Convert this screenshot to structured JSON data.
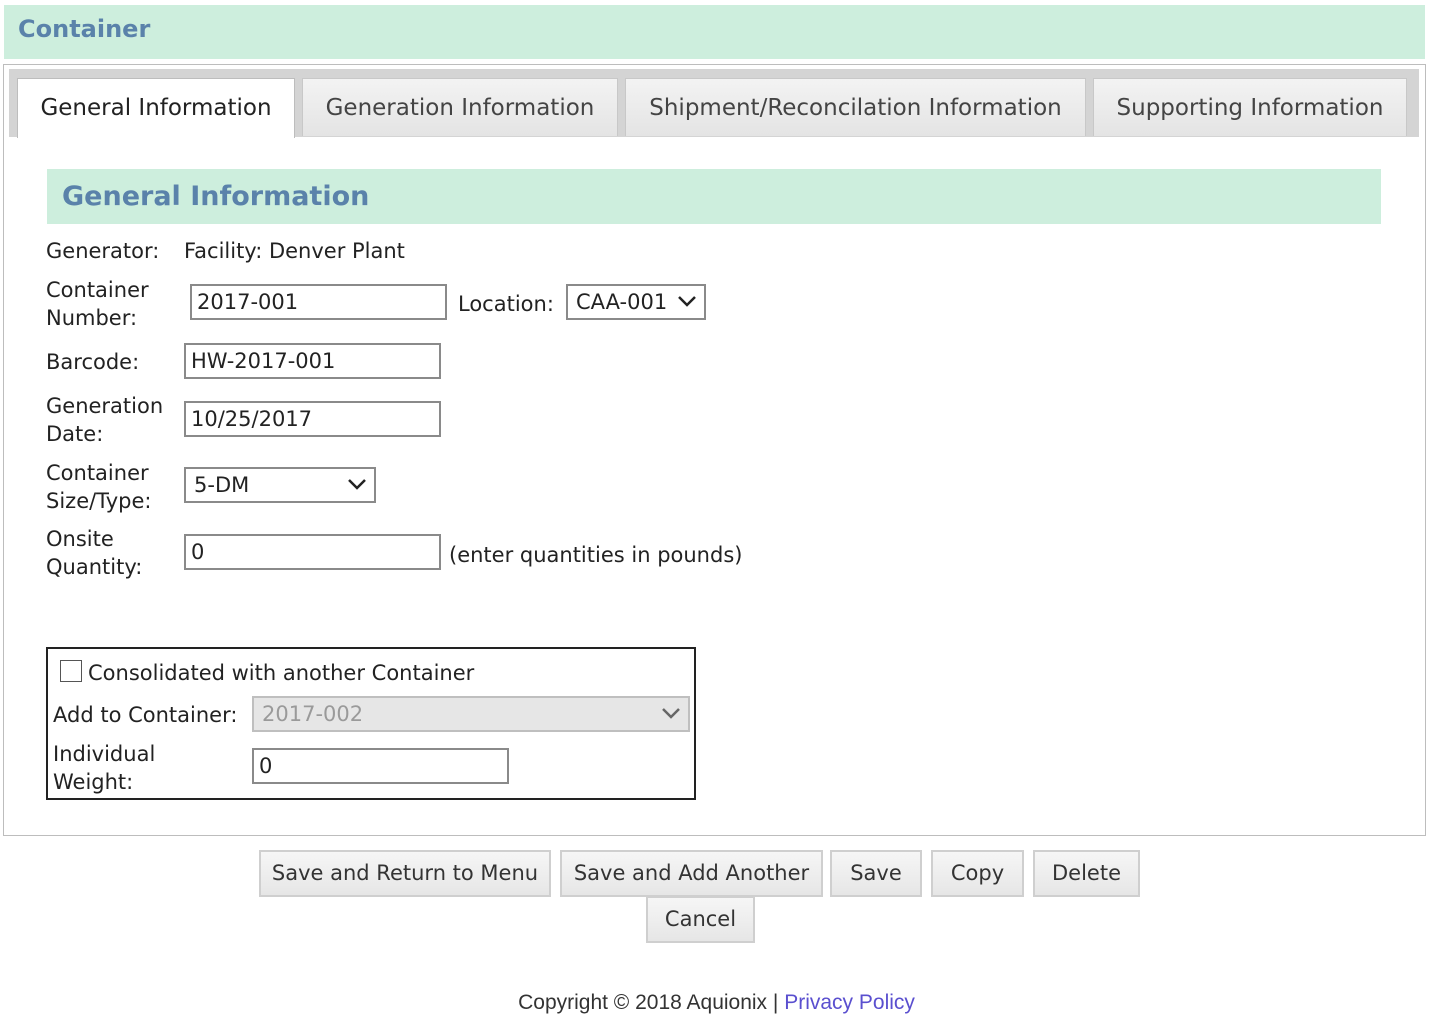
{
  "header": {
    "title": "Container"
  },
  "tabs": [
    {
      "label": "General Information",
      "active": true
    },
    {
      "label": "Generation Information",
      "active": false
    },
    {
      "label": "Shipment/Reconcilation Information",
      "active": false
    },
    {
      "label": "Supporting Information",
      "active": false
    }
  ],
  "section": {
    "title": "General Information"
  },
  "form": {
    "generator_label": "Generator:",
    "generator_value": "Facility: Denver Plant",
    "container_number_label_1": "Container",
    "container_number_label_2": "Number:",
    "container_number_value": "2017-001",
    "location_label": "Location:",
    "location_value": "CAA-001",
    "barcode_label": "Barcode:",
    "barcode_value": "HW-2017-001",
    "generation_date_label_1": "Generation",
    "generation_date_label_2": "Date:",
    "generation_date_value": "10/25/2017",
    "container_size_label_1": "Container",
    "container_size_label_2": "Size/Type:",
    "container_size_value": "5-DM",
    "onsite_quantity_label_1": "Onsite",
    "onsite_quantity_label_2": "Quantity:",
    "onsite_quantity_value": "0",
    "onsite_quantity_hint": "(enter quantities in pounds)"
  },
  "consolidation": {
    "checkbox_label": "Consolidated with another Container",
    "checked": false,
    "add_to_label": "Add to Container:",
    "add_to_value": "2017-002",
    "weight_label_1": "Individual",
    "weight_label_2": "Weight:",
    "weight_value": "0"
  },
  "buttons": {
    "save_return": "Save and Return to Menu",
    "save_add": "Save and Add Another",
    "save": "Save",
    "copy": "Copy",
    "delete": "Delete",
    "cancel": "Cancel"
  },
  "footer": {
    "copyright": "Copyright © 2018 Aquionix |",
    "privacy": "Privacy Policy"
  },
  "colors": {
    "header_bg": "#cdeedd",
    "title_text": "#5a82aa",
    "link": "#5a4fcf"
  }
}
